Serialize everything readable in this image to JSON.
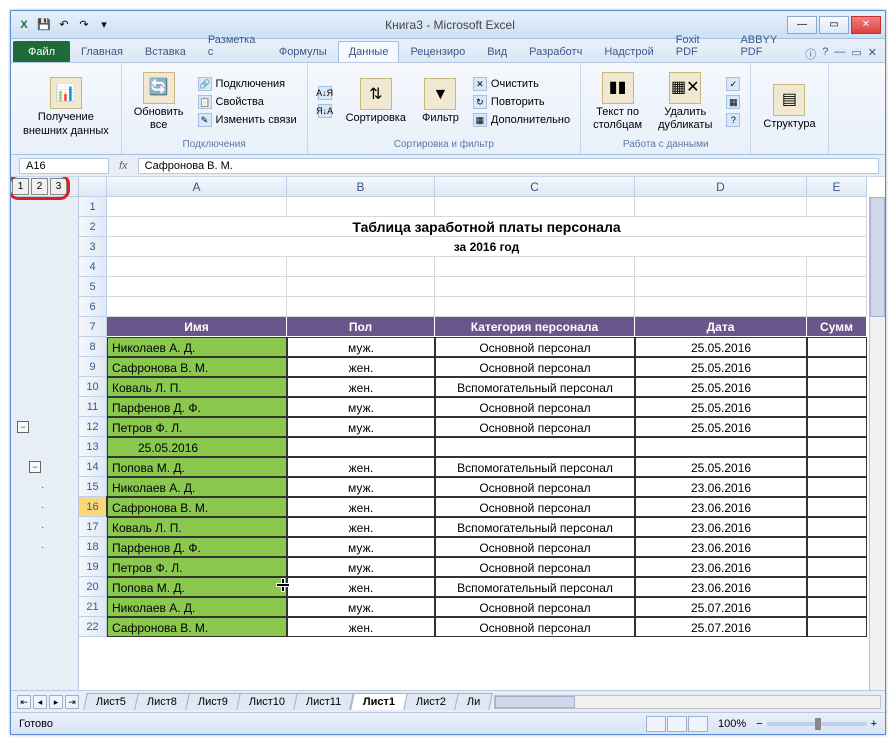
{
  "window": {
    "title": "Книга3 - Microsoft Excel"
  },
  "qat": {
    "excel_icon": "X",
    "save": "💾",
    "undo": "↶",
    "redo": "↷"
  },
  "win_controls": {
    "min": "—",
    "max": "▭",
    "close": "✕"
  },
  "ribbon": {
    "tabs": [
      "Файл",
      "Главная",
      "Вставка",
      "Разметка с",
      "Формулы",
      "Данные",
      "Рецензиро",
      "Вид",
      "Разработч",
      "Надстрой",
      "Foxit PDF",
      "ABBYY PDF"
    ],
    "active_index": 5,
    "help": [
      "ⓘ",
      "?",
      "—",
      "▭",
      "✕"
    ],
    "groups": {
      "external": {
        "btn": "Получение\nвнешних данных",
        "label": ""
      },
      "connections": {
        "refresh": "Обновить\nвсе",
        "sub": [
          "Подключения",
          "Свойства",
          "Изменить связи"
        ],
        "label": "Подключения"
      },
      "sort": {
        "az": "А↓Я",
        "za": "Я↓А",
        "sort_btn": "Сортировка",
        "filter_btn": "Фильтр",
        "sub": [
          "Очистить",
          "Повторить",
          "Дополнительно"
        ],
        "label": "Сортировка и фильтр"
      },
      "data_tools": {
        "ttc": "Текст по\nстолбцам",
        "dup": "Удалить\nдубликаты",
        "label": "Работа с данными"
      },
      "outline": {
        "btn": "Структура",
        "label": ""
      }
    }
  },
  "namebox": {
    "ref": "A16",
    "fx": "fx",
    "formula": "Сафронова В. М."
  },
  "outline_levels": [
    "1",
    "2",
    "3"
  ],
  "columns": [
    "",
    "A",
    "B",
    "C",
    "D",
    "E"
  ],
  "title_row": "Таблица заработной платы персонала",
  "subtitle_row": "за 2016 год",
  "headers": [
    "Имя",
    "Пол",
    "Категория персонала",
    "Дата",
    "Сумм"
  ],
  "rows": [
    {
      "n": 8,
      "name": "Николаев А. Д.",
      "sex": "муж.",
      "cat": "Основной персонал",
      "date": "25.05.2016"
    },
    {
      "n": 9,
      "name": "Сафронова В. М.",
      "sex": "жен.",
      "cat": "Основной персонал",
      "date": "25.05.2016"
    },
    {
      "n": 10,
      "name": "Коваль Л. П.",
      "sex": "жен.",
      "cat": "Вспомогательный персонал",
      "date": "25.05.2016"
    },
    {
      "n": 11,
      "name": "Парфенов Д. Ф.",
      "sex": "муж.",
      "cat": "Основной персонал",
      "date": "25.05.2016"
    },
    {
      "n": 12,
      "name": "Петров Ф. Л.",
      "sex": "муж.",
      "cat": "Основной персонал",
      "date": "25.05.2016"
    },
    {
      "n": 13,
      "name": "25.05.2016",
      "sex": "",
      "cat": "",
      "date": "",
      "indent": true
    },
    {
      "n": 14,
      "name": "Попова М. Д.",
      "sex": "жен.",
      "cat": "Вспомогательный персонал",
      "date": "25.05.2016"
    },
    {
      "n": 15,
      "name": "Николаев А. Д.",
      "sex": "муж.",
      "cat": "Основной персонал",
      "date": "23.06.2016"
    },
    {
      "n": 16,
      "name": "Сафронова В. М.",
      "sex": "жен.",
      "cat": "Основной персонал",
      "date": "23.06.2016",
      "selected": true
    },
    {
      "n": 17,
      "name": "Коваль Л. П.",
      "sex": "жен.",
      "cat": "Вспомогательный персонал",
      "date": "23.06.2016"
    },
    {
      "n": 18,
      "name": "Парфенов Д. Ф.",
      "sex": "муж.",
      "cat": "Основной персонал",
      "date": "23.06.2016"
    },
    {
      "n": 19,
      "name": "Петров Ф. Л.",
      "sex": "муж.",
      "cat": "Основной персонал",
      "date": "23.06.2016"
    },
    {
      "n": 20,
      "name": "Попова М. Д.",
      "sex": "жен.",
      "cat": "Вспомогательный персонал",
      "date": "23.06.2016"
    },
    {
      "n": 21,
      "name": "Николаев А. Д.",
      "sex": "муж.",
      "cat": "Основной персонал",
      "date": "25.07.2016"
    },
    {
      "n": 22,
      "name": "Сафронова В. М.",
      "sex": "жен.",
      "cat": "Основной персонал",
      "date": "25.07.2016"
    }
  ],
  "sheet_tabs": [
    "Лист5",
    "Лист8",
    "Лист9",
    "Лист10",
    "Лист11",
    "Лист1",
    "Лист2",
    "Ли"
  ],
  "active_sheet_index": 5,
  "status": {
    "ready": "Готово",
    "zoom": "100%",
    "zoom_minus": "−",
    "zoom_plus": "+"
  }
}
